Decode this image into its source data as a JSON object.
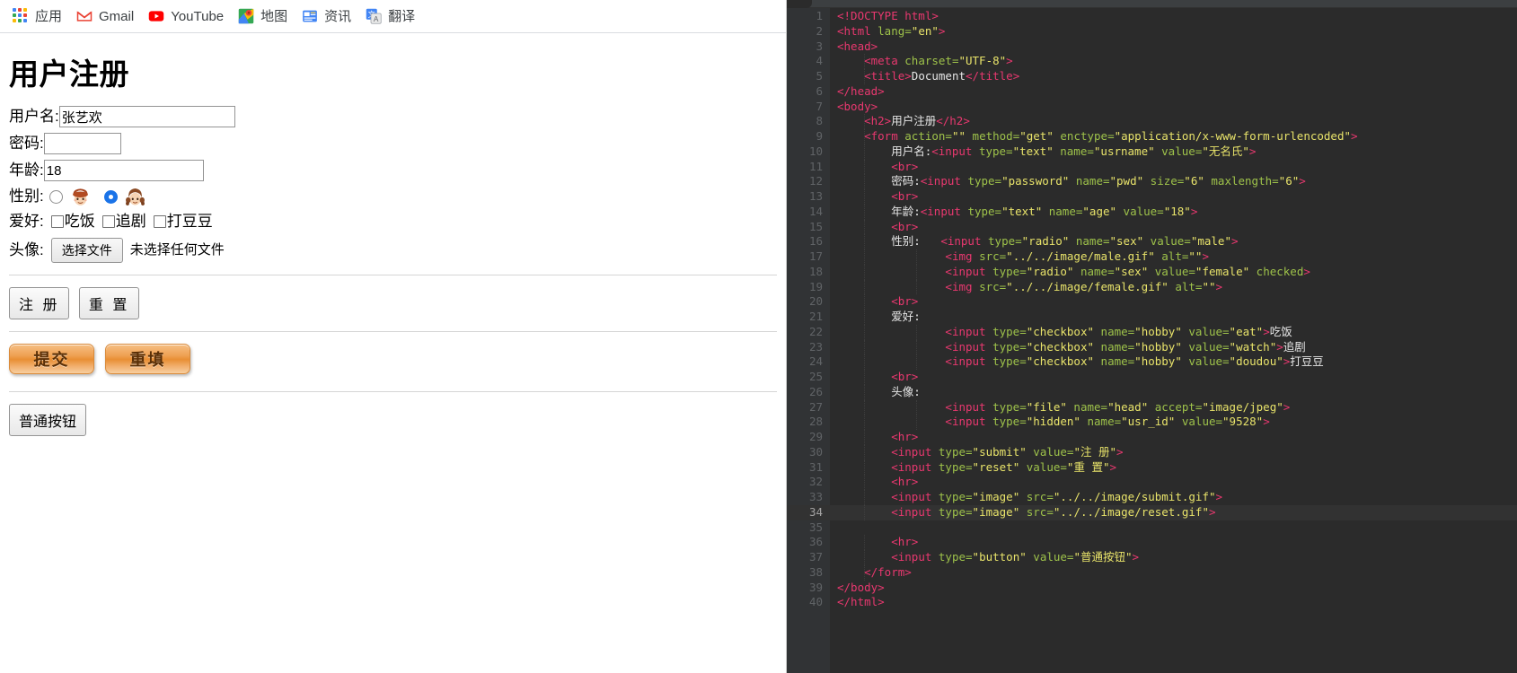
{
  "browser": {
    "bookmarks": [
      {
        "label": "应用",
        "icon": "apps-grid-icon"
      },
      {
        "label": "Gmail",
        "icon": "gmail-icon"
      },
      {
        "label": "YouTube",
        "icon": "youtube-icon"
      },
      {
        "label": "地图",
        "icon": "google-maps-icon"
      },
      {
        "label": "资讯",
        "icon": "google-news-icon"
      },
      {
        "label": "翻译",
        "icon": "google-translate-icon"
      }
    ]
  },
  "page": {
    "heading": "用户注册",
    "fields": {
      "username_label": "用户名:",
      "username_value": "张艺欢",
      "password_label": "密码:",
      "password_value": "",
      "age_label": "年龄:",
      "age_value": "18",
      "gender_label": "性别:",
      "gender_male_icon": "male-avatar-icon",
      "gender_female_icon": "female-avatar-icon",
      "gender_selected": "female",
      "hobby_label": "爱好:",
      "hobbies": [
        {
          "label": "吃饭",
          "checked": false
        },
        {
          "label": "追剧",
          "checked": false
        },
        {
          "label": "打豆豆",
          "checked": false
        }
      ],
      "avatar_label": "头像:",
      "file_button": "选择文件",
      "file_status": "未选择任何文件"
    },
    "buttons": {
      "submit": "注 册",
      "reset": "重 置",
      "image_submit": "提交",
      "image_reset": "重填",
      "plain": "普通按钮"
    }
  },
  "editor": {
    "active_line": 34,
    "total_lines": 40,
    "colors": {
      "background": "#2b2b2b",
      "gutter": "#313335",
      "tag": "#e8386f",
      "attribute": "#9ec24a",
      "string": "#e8e36a",
      "text": "#e6e6e6",
      "active_line": "#323232"
    },
    "lines": [
      {
        "n": 1,
        "indent": 0,
        "tokens": [
          {
            "t": "tg",
            "v": "<!DOCTYPE html>"
          }
        ]
      },
      {
        "n": 2,
        "indent": 0,
        "tokens": [
          {
            "t": "tg",
            "v": "<html "
          },
          {
            "t": "at",
            "v": "lang="
          },
          {
            "t": "st",
            "v": "\"en\""
          },
          {
            "t": "tg",
            "v": ">"
          }
        ]
      },
      {
        "n": 3,
        "indent": 0,
        "tokens": [
          {
            "t": "tg",
            "v": "<head>"
          }
        ]
      },
      {
        "n": 4,
        "indent": 1,
        "tokens": [
          {
            "t": "tg",
            "v": "<meta "
          },
          {
            "t": "at",
            "v": "charset="
          },
          {
            "t": "st",
            "v": "\"UTF-8\""
          },
          {
            "t": "tg",
            "v": ">"
          }
        ]
      },
      {
        "n": 5,
        "indent": 1,
        "tokens": [
          {
            "t": "tg",
            "v": "<title>"
          },
          {
            "t": "tx",
            "v": "Document"
          },
          {
            "t": "tg",
            "v": "</title>"
          }
        ]
      },
      {
        "n": 6,
        "indent": 0,
        "tokens": [
          {
            "t": "tg",
            "v": "</head>"
          }
        ]
      },
      {
        "n": 7,
        "indent": 0,
        "tokens": [
          {
            "t": "tg",
            "v": "<body>"
          }
        ]
      },
      {
        "n": 8,
        "indent": 1,
        "tokens": [
          {
            "t": "tg",
            "v": "<h2>"
          },
          {
            "t": "tx",
            "v": "用户注册"
          },
          {
            "t": "tg",
            "v": "</h2>"
          }
        ]
      },
      {
        "n": 9,
        "indent": 1,
        "tokens": [
          {
            "t": "tg",
            "v": "<form "
          },
          {
            "t": "at",
            "v": "action="
          },
          {
            "t": "st",
            "v": "\"\""
          },
          {
            "t": "at",
            "v": " method="
          },
          {
            "t": "st",
            "v": "\"get\""
          },
          {
            "t": "at",
            "v": " enctype="
          },
          {
            "t": "st",
            "v": "\"application/x-www-form-urlencoded\""
          },
          {
            "t": "tg",
            "v": ">"
          }
        ]
      },
      {
        "n": 10,
        "indent": 2,
        "tokens": [
          {
            "t": "tx",
            "v": "用户名:"
          },
          {
            "t": "tg",
            "v": "<input "
          },
          {
            "t": "at",
            "v": "type="
          },
          {
            "t": "st",
            "v": "\"text\""
          },
          {
            "t": "at",
            "v": " name="
          },
          {
            "t": "st",
            "v": "\"usrname\""
          },
          {
            "t": "at",
            "v": " value="
          },
          {
            "t": "st",
            "v": "\"无名氏\""
          },
          {
            "t": "tg",
            "v": ">"
          }
        ]
      },
      {
        "n": 11,
        "indent": 2,
        "tokens": [
          {
            "t": "tg",
            "v": "<br>"
          }
        ]
      },
      {
        "n": 12,
        "indent": 2,
        "tokens": [
          {
            "t": "tx",
            "v": "密码:"
          },
          {
            "t": "tg",
            "v": "<input "
          },
          {
            "t": "at",
            "v": "type="
          },
          {
            "t": "st",
            "v": "\"password\""
          },
          {
            "t": "at",
            "v": " name="
          },
          {
            "t": "st",
            "v": "\"pwd\""
          },
          {
            "t": "at",
            "v": " size="
          },
          {
            "t": "st",
            "v": "\"6\""
          },
          {
            "t": "at",
            "v": " maxlength="
          },
          {
            "t": "st",
            "v": "\"6\""
          },
          {
            "t": "tg",
            "v": ">"
          }
        ]
      },
      {
        "n": 13,
        "indent": 2,
        "tokens": [
          {
            "t": "tg",
            "v": "<br>"
          }
        ]
      },
      {
        "n": 14,
        "indent": 2,
        "tokens": [
          {
            "t": "tx",
            "v": "年龄:"
          },
          {
            "t": "tg",
            "v": "<input "
          },
          {
            "t": "at",
            "v": "type="
          },
          {
            "t": "st",
            "v": "\"text\""
          },
          {
            "t": "at",
            "v": " name="
          },
          {
            "t": "st",
            "v": "\"age\""
          },
          {
            "t": "at",
            "v": " value="
          },
          {
            "t": "st",
            "v": "\"18\""
          },
          {
            "t": "tg",
            "v": ">"
          }
        ]
      },
      {
        "n": 15,
        "indent": 2,
        "tokens": [
          {
            "t": "tg",
            "v": "<br>"
          }
        ]
      },
      {
        "n": 16,
        "indent": 2,
        "tokens": [
          {
            "t": "tx",
            "v": "性别:   "
          },
          {
            "t": "tg",
            "v": "<input "
          },
          {
            "t": "at",
            "v": "type="
          },
          {
            "t": "st",
            "v": "\"radio\""
          },
          {
            "t": "at",
            "v": " name="
          },
          {
            "t": "st",
            "v": "\"sex\""
          },
          {
            "t": "at",
            "v": " value="
          },
          {
            "t": "st",
            "v": "\"male\""
          },
          {
            "t": "tg",
            "v": ">"
          }
        ]
      },
      {
        "n": 17,
        "indent": 4,
        "tokens": [
          {
            "t": "tg",
            "v": "<img "
          },
          {
            "t": "at",
            "v": "src="
          },
          {
            "t": "st",
            "v": "\"../../image/male.gif\""
          },
          {
            "t": "at",
            "v": " alt="
          },
          {
            "t": "st",
            "v": "\"\""
          },
          {
            "t": "tg",
            "v": ">"
          }
        ]
      },
      {
        "n": 18,
        "indent": 4,
        "tokens": [
          {
            "t": "tg",
            "v": "<input "
          },
          {
            "t": "at",
            "v": "type="
          },
          {
            "t": "st",
            "v": "\"radio\""
          },
          {
            "t": "at",
            "v": " name="
          },
          {
            "t": "st",
            "v": "\"sex\""
          },
          {
            "t": "at",
            "v": " value="
          },
          {
            "t": "st",
            "v": "\"female\""
          },
          {
            "t": "at",
            "v": " checked"
          },
          {
            "t": "tg",
            "v": ">"
          }
        ]
      },
      {
        "n": 19,
        "indent": 4,
        "tokens": [
          {
            "t": "tg",
            "v": "<img "
          },
          {
            "t": "at",
            "v": "src="
          },
          {
            "t": "st",
            "v": "\"../../image/female.gif\""
          },
          {
            "t": "at",
            "v": " alt="
          },
          {
            "t": "st",
            "v": "\"\""
          },
          {
            "t": "tg",
            "v": ">"
          }
        ]
      },
      {
        "n": 20,
        "indent": 2,
        "tokens": [
          {
            "t": "tg",
            "v": "<br>"
          }
        ]
      },
      {
        "n": 21,
        "indent": 2,
        "tokens": [
          {
            "t": "tx",
            "v": "爱好:"
          }
        ]
      },
      {
        "n": 22,
        "indent": 4,
        "tokens": [
          {
            "t": "tg",
            "v": "<input "
          },
          {
            "t": "at",
            "v": "type="
          },
          {
            "t": "st",
            "v": "\"checkbox\""
          },
          {
            "t": "at",
            "v": " name="
          },
          {
            "t": "st",
            "v": "\"hobby\""
          },
          {
            "t": "at",
            "v": " value="
          },
          {
            "t": "st",
            "v": "\"eat\""
          },
          {
            "t": "tg",
            "v": ">"
          },
          {
            "t": "tx",
            "v": "吃饭"
          }
        ]
      },
      {
        "n": 23,
        "indent": 4,
        "tokens": [
          {
            "t": "tg",
            "v": "<input "
          },
          {
            "t": "at",
            "v": "type="
          },
          {
            "t": "st",
            "v": "\"checkbox\""
          },
          {
            "t": "at",
            "v": " name="
          },
          {
            "t": "st",
            "v": "\"hobby\""
          },
          {
            "t": "at",
            "v": " value="
          },
          {
            "t": "st",
            "v": "\"watch\""
          },
          {
            "t": "tg",
            "v": ">"
          },
          {
            "t": "tx",
            "v": "追剧"
          }
        ]
      },
      {
        "n": 24,
        "indent": 4,
        "tokens": [
          {
            "t": "tg",
            "v": "<input "
          },
          {
            "t": "at",
            "v": "type="
          },
          {
            "t": "st",
            "v": "\"checkbox\""
          },
          {
            "t": "at",
            "v": " name="
          },
          {
            "t": "st",
            "v": "\"hobby\""
          },
          {
            "t": "at",
            "v": " value="
          },
          {
            "t": "st",
            "v": "\"doudou\""
          },
          {
            "t": "tg",
            "v": ">"
          },
          {
            "t": "tx",
            "v": "打豆豆"
          }
        ]
      },
      {
        "n": 25,
        "indent": 2,
        "tokens": [
          {
            "t": "tg",
            "v": "<br>"
          }
        ]
      },
      {
        "n": 26,
        "indent": 2,
        "tokens": [
          {
            "t": "tx",
            "v": "头像:"
          }
        ]
      },
      {
        "n": 27,
        "indent": 4,
        "tokens": [
          {
            "t": "tg",
            "v": "<input "
          },
          {
            "t": "at",
            "v": "type="
          },
          {
            "t": "st",
            "v": "\"file\""
          },
          {
            "t": "at",
            "v": " name="
          },
          {
            "t": "st",
            "v": "\"head\""
          },
          {
            "t": "at",
            "v": " accept="
          },
          {
            "t": "st",
            "v": "\"image/jpeg\""
          },
          {
            "t": "tg",
            "v": ">"
          }
        ]
      },
      {
        "n": 28,
        "indent": 4,
        "tokens": [
          {
            "t": "tg",
            "v": "<input "
          },
          {
            "t": "at",
            "v": "type="
          },
          {
            "t": "st",
            "v": "\"hidden\""
          },
          {
            "t": "at",
            "v": " name="
          },
          {
            "t": "st",
            "v": "\"usr_id\""
          },
          {
            "t": "at",
            "v": " value="
          },
          {
            "t": "st",
            "v": "\"9528\""
          },
          {
            "t": "tg",
            "v": ">"
          }
        ]
      },
      {
        "n": 29,
        "indent": 2,
        "tokens": [
          {
            "t": "tg",
            "v": "<hr>"
          }
        ]
      },
      {
        "n": 30,
        "indent": 2,
        "tokens": [
          {
            "t": "tg",
            "v": "<input "
          },
          {
            "t": "at",
            "v": "type="
          },
          {
            "t": "st",
            "v": "\"submit\""
          },
          {
            "t": "at",
            "v": " value="
          },
          {
            "t": "st",
            "v": "\"注 册\""
          },
          {
            "t": "tg",
            "v": ">"
          }
        ]
      },
      {
        "n": 31,
        "indent": 2,
        "tokens": [
          {
            "t": "tg",
            "v": "<input "
          },
          {
            "t": "at",
            "v": "type="
          },
          {
            "t": "st",
            "v": "\"reset\""
          },
          {
            "t": "at",
            "v": " value="
          },
          {
            "t": "st",
            "v": "\"重 置\""
          },
          {
            "t": "tg",
            "v": ">"
          }
        ]
      },
      {
        "n": 32,
        "indent": 2,
        "tokens": [
          {
            "t": "tg",
            "v": "<hr>"
          }
        ]
      },
      {
        "n": 33,
        "indent": 2,
        "tokens": [
          {
            "t": "tg",
            "v": "<input "
          },
          {
            "t": "at",
            "v": "type="
          },
          {
            "t": "st",
            "v": "\"image\""
          },
          {
            "t": "at",
            "v": " src="
          },
          {
            "t": "st",
            "v": "\"../../image/submit.gif\""
          },
          {
            "t": "tg",
            "v": ">"
          }
        ]
      },
      {
        "n": 34,
        "indent": 2,
        "tokens": [
          {
            "t": "tg",
            "v": "<input "
          },
          {
            "t": "at",
            "v": "type="
          },
          {
            "t": "st",
            "v": "\"image\""
          },
          {
            "t": "at",
            "v": " src="
          },
          {
            "t": "st",
            "v": "\"../../image/reset.gif\""
          },
          {
            "t": "tg",
            "v": ">"
          }
        ]
      },
      {
        "n": 35,
        "indent": 0,
        "tokens": []
      },
      {
        "n": 36,
        "indent": 2,
        "tokens": [
          {
            "t": "tg",
            "v": "<hr>"
          }
        ]
      },
      {
        "n": 37,
        "indent": 2,
        "tokens": [
          {
            "t": "tg",
            "v": "<input "
          },
          {
            "t": "at",
            "v": "type="
          },
          {
            "t": "st",
            "v": "\"button\""
          },
          {
            "t": "at",
            "v": " value="
          },
          {
            "t": "st",
            "v": "\"普通按钮\""
          },
          {
            "t": "tg",
            "v": ">"
          }
        ]
      },
      {
        "n": 38,
        "indent": 1,
        "tokens": [
          {
            "t": "tg",
            "v": "</form>"
          }
        ]
      },
      {
        "n": 39,
        "indent": 0,
        "tokens": [
          {
            "t": "tg",
            "v": "</body>"
          }
        ]
      },
      {
        "n": 40,
        "indent": 0,
        "tokens": [
          {
            "t": "tg",
            "v": "</html>"
          }
        ]
      }
    ]
  }
}
